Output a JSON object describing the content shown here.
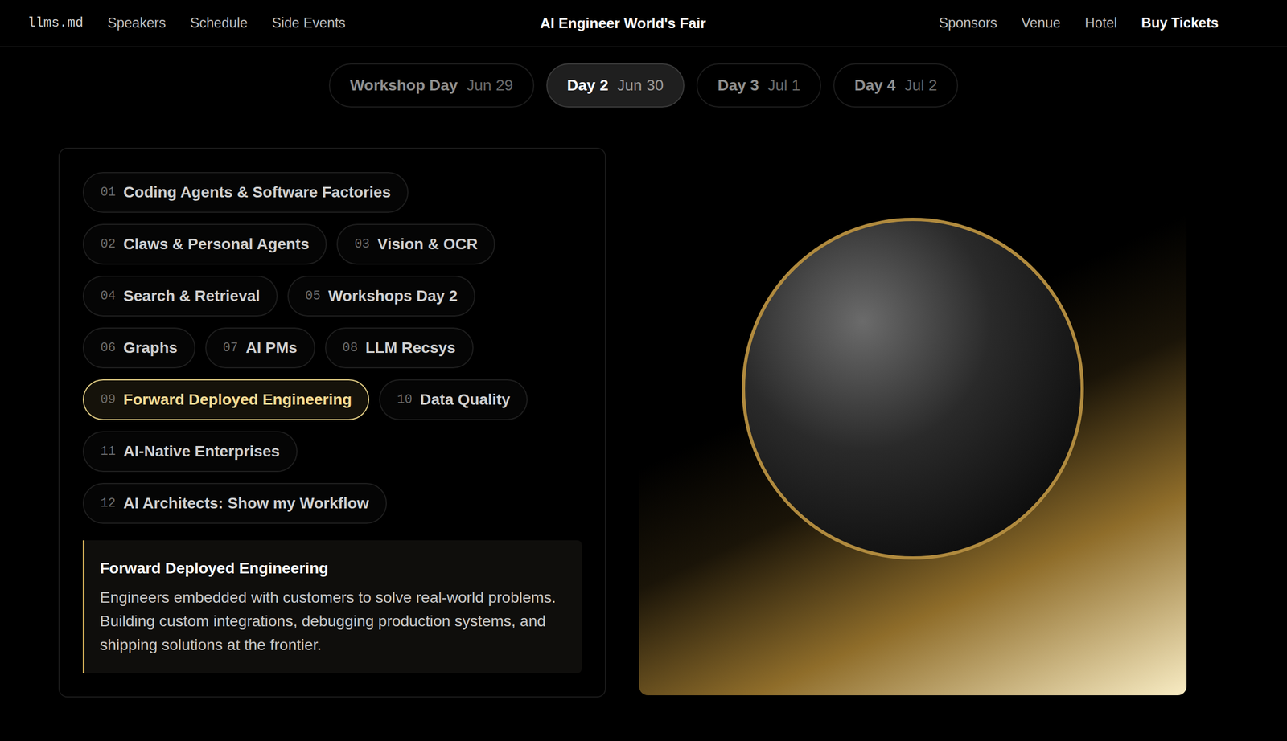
{
  "nav": {
    "logo": "llms.md",
    "left_links": [
      "Speakers",
      "Schedule",
      "Side Events"
    ],
    "title": "AI Engineer World's Fair",
    "right_links": [
      "Sponsors",
      "Venue",
      "Hotel"
    ],
    "cta": "Buy Tickets"
  },
  "days": [
    {
      "label": "Workshop Day",
      "date": "Jun 29",
      "selected": false
    },
    {
      "label": "Day 2",
      "date": "Jun 30",
      "selected": true
    },
    {
      "label": "Day 3",
      "date": "Jul 1",
      "selected": false
    },
    {
      "label": "Day 4",
      "date": "Jul 2",
      "selected": false
    }
  ],
  "topic_rows": [
    [
      {
        "number": "01",
        "label": "Coding Agents & Software Factories",
        "selected": false
      }
    ],
    [
      {
        "number": "02",
        "label": "Claws & Personal Agents",
        "selected": false
      },
      {
        "number": "03",
        "label": "Vision & OCR",
        "selected": false
      }
    ],
    [
      {
        "number": "04",
        "label": "Search & Retrieval",
        "selected": false
      },
      {
        "number": "05",
        "label": "Workshops Day 2",
        "selected": false
      }
    ],
    [
      {
        "number": "06",
        "label": "Graphs",
        "selected": false
      },
      {
        "number": "07",
        "label": "AI PMs",
        "selected": false
      },
      {
        "number": "08",
        "label": "LLM Recsys",
        "selected": false
      }
    ],
    [
      {
        "number": "09",
        "label": "Forward Deployed Engineering",
        "selected": true
      },
      {
        "number": "10",
        "label": "Data Quality",
        "selected": false
      }
    ],
    [
      {
        "number": "11",
        "label": "AI-Native Enterprises",
        "selected": false
      }
    ],
    [
      {
        "number": "12",
        "label": "AI Architects: Show my Workflow",
        "selected": false
      }
    ]
  ],
  "description": {
    "title": "Forward Deployed Engineering",
    "body": "Engineers embedded with customers to solve real-world problems. Building custom integrations, debugging production systems, and shipping solutions at the frontier."
  }
}
